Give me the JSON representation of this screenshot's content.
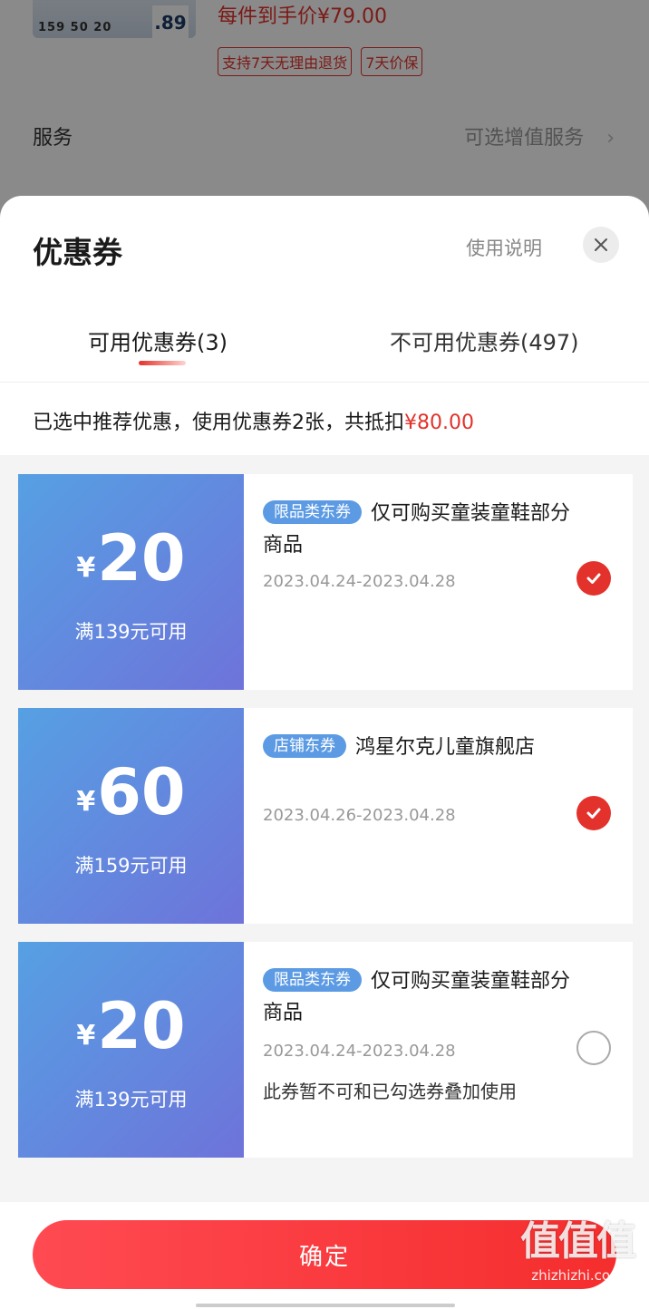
{
  "background_page": {
    "thumb_numbers": "159  50  20",
    "thumb_big": ".89",
    "price": "每件到手价¥79.00",
    "tags": [
      "支持7天无理由退货",
      "7天价保"
    ],
    "service_label": "服务",
    "service_value": "可选增值服务",
    "service_arrow": "›"
  },
  "sheet": {
    "title": "优惠券",
    "usage_link": "使用说明",
    "tabs": [
      {
        "label": "可用优惠券(3)",
        "active": true
      },
      {
        "label": "不可用优惠券(497)",
        "active": false
      }
    ],
    "summary_prefix": "已选中推荐优惠，使用优惠券2张，共抵扣",
    "summary_amount": "¥80.00"
  },
  "coupons": [
    {
      "currency": "¥",
      "amount": "20",
      "condition": "满139元可用",
      "badge": "限品类东券",
      "name": "仅可购买童装童鞋部分商品",
      "date": "2023.04.24-2023.04.28",
      "note": "",
      "selected": true
    },
    {
      "currency": "¥",
      "amount": "60",
      "condition": "满159元可用",
      "badge": "店铺东券",
      "name": "鸿星尔克儿童旗舰店",
      "date": "2023.04.26-2023.04.28",
      "note": "",
      "selected": true
    },
    {
      "currency": "¥",
      "amount": "20",
      "condition": "满139元可用",
      "badge": "限品类东券",
      "name": "仅可购买童装童鞋部分商品",
      "date": "2023.04.24-2023.04.28",
      "note": "此券暂不可和已勾选券叠加使用",
      "selected": false
    }
  ],
  "confirm_label": "确定",
  "watermark": {
    "logo": "值值值",
    "site": "zhizhizhi.com"
  },
  "colors": {
    "accent": "#e3322b",
    "coupon_gradient_start": "#56a0e3",
    "coupon_gradient_end": "#6e73da",
    "badge": "#5c9be4"
  }
}
